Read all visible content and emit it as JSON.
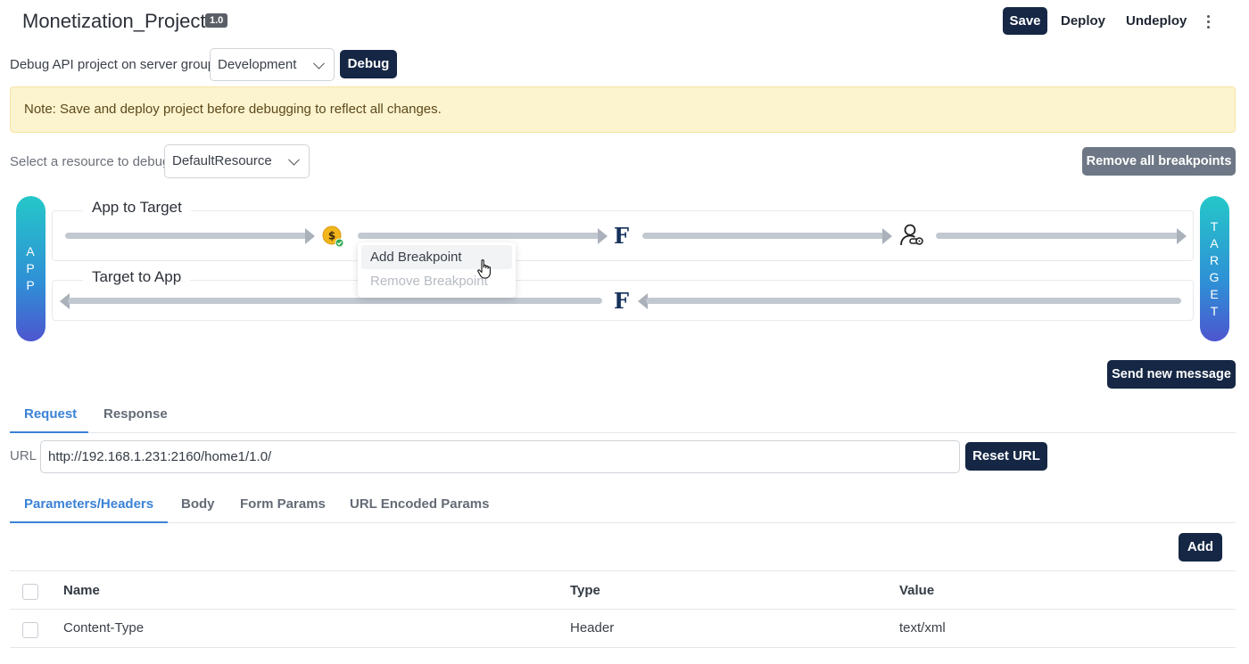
{
  "header": {
    "project_name": "Monetization_Project",
    "version": "1.0",
    "save_label": "Save",
    "deploy_label": "Deploy",
    "undeploy_label": "Undeploy",
    "more_icon": "kebab-vertical-icon"
  },
  "debug_bar": {
    "label": "Debug API project on server group",
    "server_group": "Development",
    "debug_label": "Debug"
  },
  "note": "Note: Save and deploy project before debugging to reflect all changes.",
  "resource": {
    "label": "Select a resource to debug",
    "selected": "DefaultResource",
    "remove_all_label": "Remove all breakpoints"
  },
  "flow": {
    "app_label": [
      "A",
      "P",
      "P"
    ],
    "target_label": [
      "T",
      "A",
      "R",
      "G",
      "E",
      "T"
    ],
    "request_lane_title": "App to Target",
    "response_lane_title": "Target to App",
    "request_policies": [
      "monetization-coin-icon",
      "f-policy-icon",
      "user-key-icon"
    ],
    "response_policies": [
      "f-policy-icon"
    ],
    "policy_glyph": "F",
    "coin_glyph": "$",
    "context_menu": {
      "add_label": "Add Breakpoint",
      "remove_label": "Remove Breakpoint"
    },
    "colors": {
      "pill_top": "#25c7c9",
      "pill_bottom": "#4d56cf",
      "policy": "#16325c"
    }
  },
  "send_label": "Send new message",
  "main_tabs": [
    {
      "label": "Request",
      "active": true
    },
    {
      "label": "Response",
      "active": false
    }
  ],
  "url": {
    "label": "URL",
    "value": "http://192.168.1.231:2160/home1/1.0/",
    "reset_label": "Reset URL"
  },
  "sub_tabs": [
    {
      "label": "Parameters/Headers",
      "active": true
    },
    {
      "label": "Body",
      "active": false
    },
    {
      "label": "Form Params",
      "active": false
    },
    {
      "label": "URL Encoded Params",
      "active": false
    }
  ],
  "params": {
    "add_label": "Add",
    "columns": [
      "Name",
      "Type",
      "Value"
    ],
    "rows": [
      {
        "name": "Content-Type",
        "type": "Header",
        "value": "text/xml"
      }
    ]
  },
  "theme": {
    "dark": "#152744",
    "accent": "#3b82d6",
    "note_bg": "#fcf3cf",
    "muted_button": "#6e7785"
  }
}
